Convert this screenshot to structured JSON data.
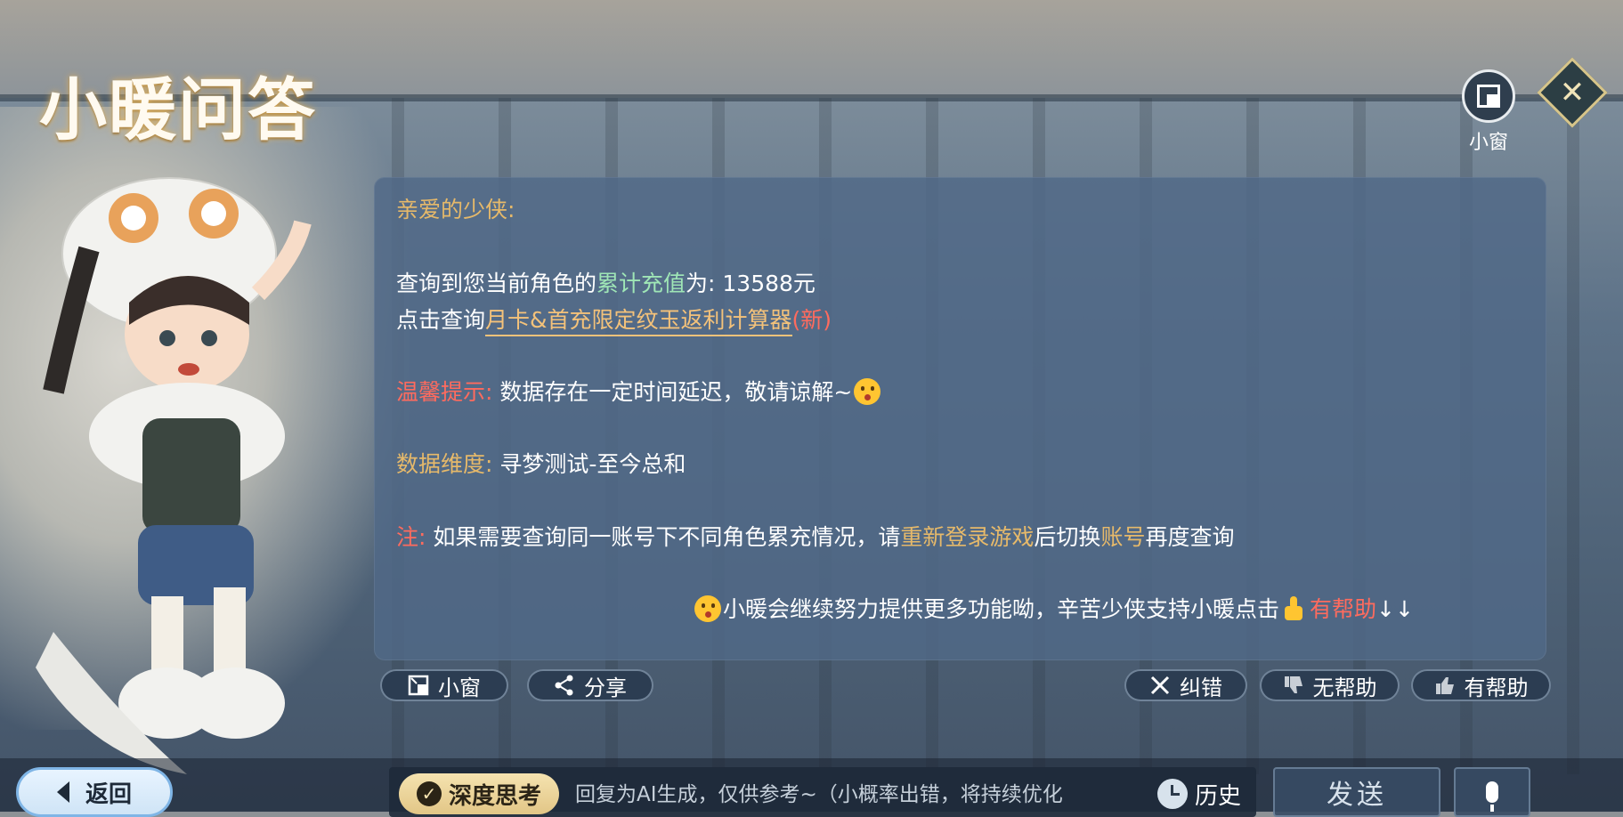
{
  "header": {
    "title": "小暖问答",
    "mini_window_label": "小窗",
    "close_icon": "close-diamond-icon"
  },
  "message": {
    "greeting": "亲爱的少侠:",
    "query_prefix": "查询到您当前角色的",
    "query_highlight": "累计充值",
    "query_suffix": "为: 13588元",
    "link_prefix": "点击查询",
    "link_text": "月卡&首充限定纹玉返利计算器",
    "link_new": "(新)",
    "tip_label": "温馨提示:",
    "tip_text": "数据存在一定时间延迟，敬请谅解~",
    "dimension_label": "数据维度:",
    "dimension_text": "寻梦测试-至今总和",
    "note_label": "注:",
    "note_text_1": "如果需要查询同一账号下不同角色累充情况，请",
    "note_highlight_1": "重新登录游戏",
    "note_text_2": "后切换",
    "note_highlight_2": "账号",
    "note_text_3": "再度查询",
    "footer_text": "小暖会继续努力提供更多功能呦，辛苦少侠支持小暖点击",
    "footer_helpful": "有帮助",
    "footer_arrows": "↓↓"
  },
  "actions": {
    "mini_window": "小窗",
    "share": "分享",
    "correct": "纠错",
    "not_helpful": "无帮助",
    "helpful": "有帮助"
  },
  "bottom": {
    "back": "返回",
    "deep_think": "深度思考",
    "input_placeholder": "回复为AI生成，仅供参考~（小概率出错，将持续优化",
    "history": "历史",
    "send": "发送"
  },
  "colors": {
    "card_bg": "#50698780",
    "gold": "#e6b96a",
    "green": "#9fe6b6",
    "red": "#ff6b5e"
  }
}
